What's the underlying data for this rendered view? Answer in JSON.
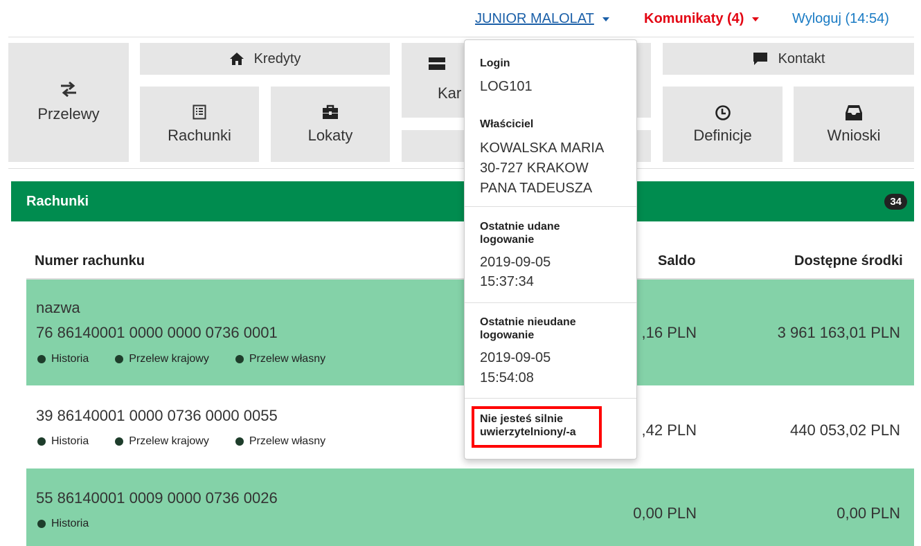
{
  "topbar": {
    "user": "JUNIOR MALOLAT",
    "messages": "Komunikaty (4)",
    "logout": "Wyloguj (14:54)"
  },
  "tiles": {
    "przelewy": "Przelewy",
    "kredyty": "Kredyty",
    "rachunki": "Rachunki",
    "lokaty": "Lokaty",
    "karty_partial": "Kar",
    "kontakt": "Kontakt",
    "definicje": "Definicje",
    "wnioski": "Wnioski"
  },
  "icons": {
    "transfer": "transfer-arrows-icon",
    "home": "home-icon",
    "list": "list-icon",
    "briefcase": "briefcase-icon",
    "card": "card-icon",
    "chat": "chat-icon",
    "clock": "clock-icon",
    "inbox": "inbox-icon"
  },
  "panel": {
    "title": "Rachunki",
    "count": "34",
    "col_number": "Numer rachunku",
    "col_balance": "Saldo",
    "col_available": "Dostępne środki"
  },
  "accounts": [
    {
      "name": "nazwa",
      "number": "76 86140001 0000 0000 0736 0001",
      "links": [
        "Historia",
        "Przelew krajowy",
        "Przelew własny"
      ],
      "balance_partial": ",16 PLN",
      "available": "3 961 163,01 PLN"
    },
    {
      "number": "39 86140001 0000 0736 0000 0055",
      "links": [
        "Historia",
        "Przelew krajowy",
        "Przelew własny"
      ],
      "balance_partial": ",42 PLN",
      "available": "440 053,02 PLN"
    },
    {
      "number": "55 86140001 0009 0000 0736 0026",
      "links": [
        "Historia"
      ],
      "balance": "0,00 PLN",
      "available": "0,00 PLN"
    }
  ],
  "dropdown": {
    "login_label": "Login",
    "login_value": "LOG101",
    "owner_label": "Właściciel",
    "owner_line1": "KOWALSKA MARIA",
    "owner_line2": "30-727 KRAKOW",
    "owner_line3": "PANA TADEUSZA",
    "last_ok_label1": "Ostatnie udane",
    "last_ok_label2": "logowanie",
    "last_ok_date": "2019-09-05",
    "last_ok_time": "15:37:34",
    "last_fail_label1": "Ostatnie nieudane",
    "last_fail_label2": "logowanie",
    "last_fail_date": "2019-09-05",
    "last_fail_time": "15:54:08",
    "strong_auth_line1": "Nie jesteś silnie",
    "strong_auth_line2": "uwierzytelniony/-a"
  },
  "colors": {
    "header_green": "#008c4f",
    "row_green": "#84d2a8",
    "alert_red": "#e30613",
    "link_blue": "#1a5fa8"
  }
}
